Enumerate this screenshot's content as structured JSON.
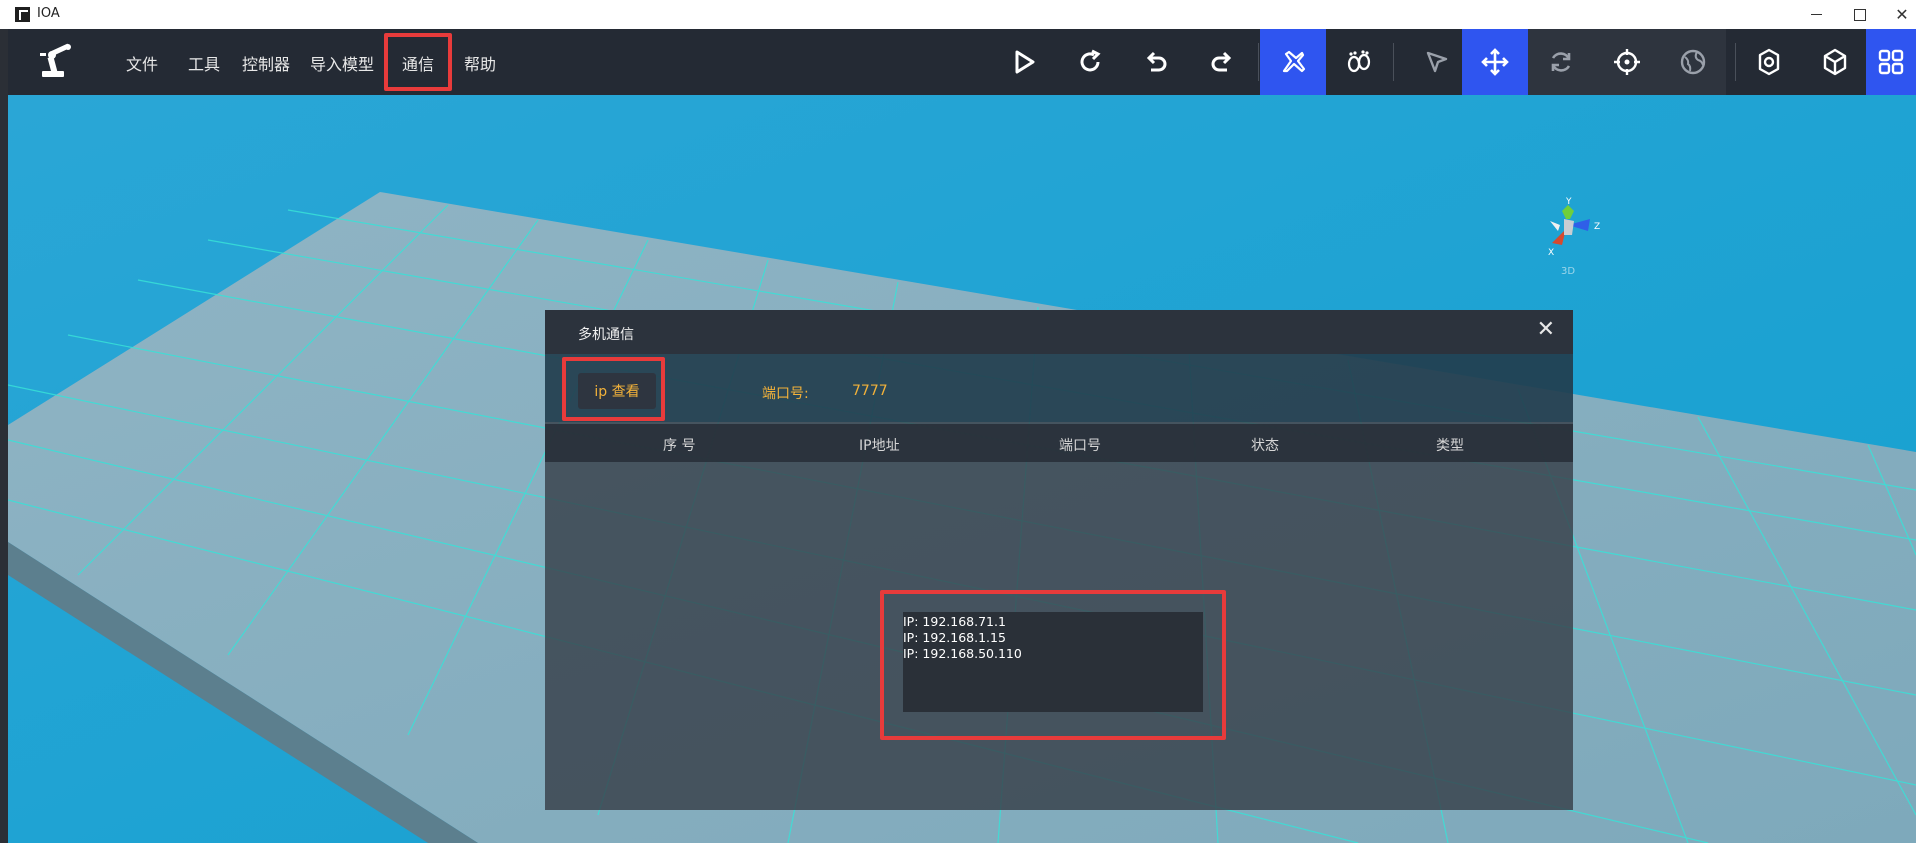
{
  "window": {
    "title": "IOA",
    "controls": {
      "minimize_icon": "minimize-icon",
      "maximize_icon": "maximize-icon",
      "close_glyph": "✕"
    }
  },
  "menu": {
    "items": [
      "文件",
      "工具",
      "控制器",
      "导入模型",
      "通信",
      "帮助"
    ],
    "highlighted": "通信"
  },
  "toolbar_icons": [
    "play-icon",
    "redo-rotate-icon",
    "undo-icon",
    "redo-icon",
    "fly-icon",
    "footprints-icon",
    "pointer-icon",
    "move-arrows-icon",
    "sync-icon",
    "target-icon",
    "globe-icon",
    "settings-icon",
    "cube-icon",
    "grid-apps-icon"
  ],
  "gizmo": {
    "axis_y": "Y",
    "axis_x": "X",
    "axis_z": "Z",
    "mode": "3D"
  },
  "dialog": {
    "title": "多机通信",
    "close_glyph": "✕",
    "ip_button": "ip 查看",
    "port_label": "端口号:",
    "port_value": "7777",
    "columns": [
      "序 号",
      "IP地址",
      "端口号",
      "状态",
      "类型"
    ],
    "ip_list": [
      "IP:  192.168.71.1",
      "IP:  192.168.1.15",
      "IP:  192.168.50.110"
    ]
  },
  "colors": {
    "highlight": "#e83b3b",
    "accent_blue": "#2f55f0",
    "port_text": "#f3b23a",
    "toolbar_bg": "#242a34",
    "sky": "#1a9fd0"
  }
}
